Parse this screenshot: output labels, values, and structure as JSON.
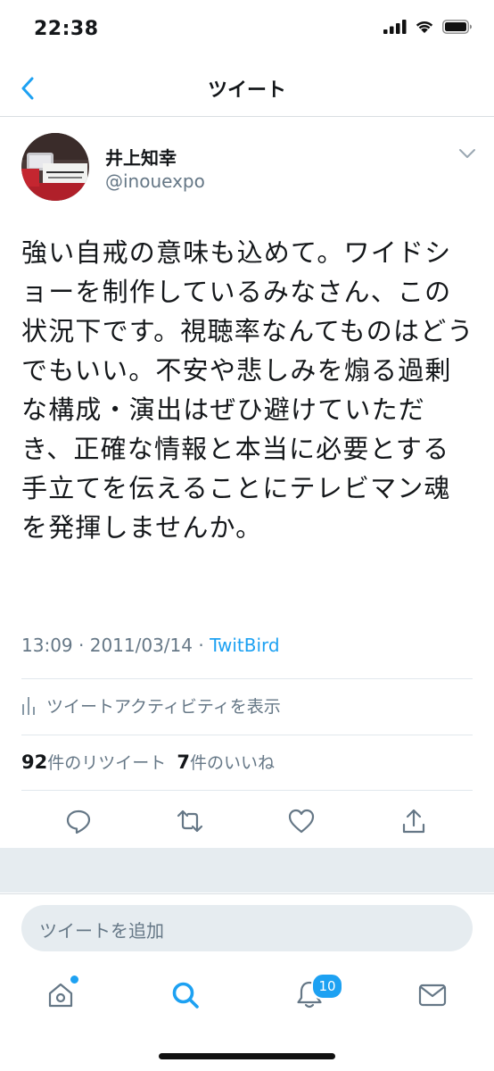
{
  "status_bar": {
    "time": "22:38"
  },
  "nav": {
    "title": "ツイート"
  },
  "tweet": {
    "author_name": "井上知幸",
    "author_handle": "@inouexpo",
    "text": "強い自戒の意味も込めて。ワイドショーを制作しているみなさん、この状況下です。視聴率なんてものはどうでもいい。不安や悲しみを煽る過剰な構成・演出はぜひ避けていただき、正確な情報と本当に必要とする手立てを伝えることにテレビマン魂を発揮しませんか。",
    "time": "13:09",
    "separator": " · ",
    "date": "2011/03/14",
    "source": "TwitBird",
    "activity_label": "ツイートアクティビティを表示",
    "retweet_count": "92",
    "retweet_label": "件のリツイート",
    "like_count": "7",
    "like_label": "件のいいね"
  },
  "compose": {
    "placeholder": "ツイートを追加"
  },
  "tabs": [
    {
      "icon": "home-icon"
    },
    {
      "icon": "search-icon"
    },
    {
      "icon": "notifications-icon",
      "badge": "10"
    },
    {
      "icon": "messages-icon"
    }
  ],
  "colors": {
    "accent": "#1da1f2",
    "secondary_text": "#657786",
    "divider": "#e1e8ed",
    "gap": "#e6ecf0"
  }
}
